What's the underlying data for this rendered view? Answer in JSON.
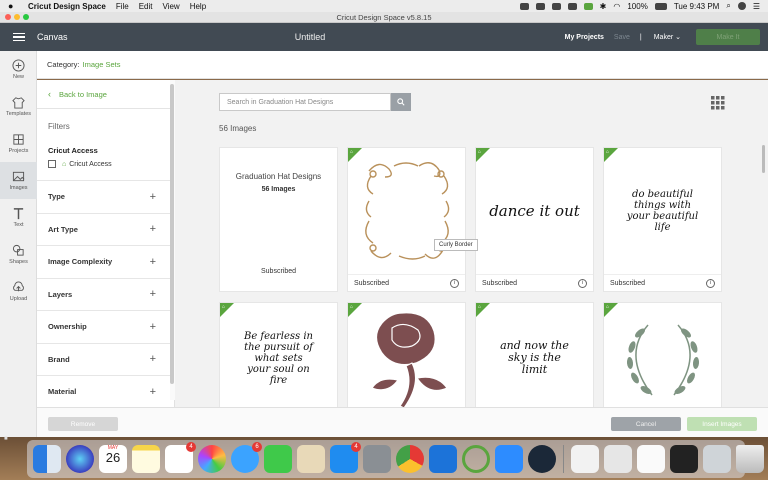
{
  "menubar": {
    "apple": "",
    "items": [
      "Cricut Design Space",
      "File",
      "Edit",
      "View",
      "Help"
    ],
    "battery": "100%",
    "clock": "Tue 9:43 PM"
  },
  "window": {
    "title": "Cricut Design Space  v5.8.15"
  },
  "header": {
    "canvas_label": "Canvas",
    "doc_title": "Untitled",
    "my_projects": "My Projects",
    "save": "Save",
    "divider": "|",
    "machine": "Maker",
    "make_it": "Make It"
  },
  "toolbar": [
    {
      "label": "New",
      "icon": "plus-circle-icon"
    },
    {
      "label": "Templates",
      "icon": "shirt-icon"
    },
    {
      "label": "Projects",
      "icon": "projects-icon"
    },
    {
      "label": "Images",
      "icon": "image-icon"
    },
    {
      "label": "Text",
      "icon": "text-icon"
    },
    {
      "label": "Shapes",
      "icon": "shapes-icon"
    },
    {
      "label": "Upload",
      "icon": "upload-icon"
    }
  ],
  "category": {
    "label": "Category:",
    "value": "Image Sets"
  },
  "filters": {
    "back": "Back to Image",
    "title": "Filters",
    "access_heading": "Cricut Access",
    "access_option": "Cricut Access",
    "facets": [
      "Type",
      "Art Type",
      "Image Complexity",
      "Layers",
      "Ownership",
      "Brand",
      "Material"
    ]
  },
  "search": {
    "placeholder": "Search in Graduation Hat Designs"
  },
  "results": {
    "count": "56 Images"
  },
  "set_card": {
    "title": "Graduation Hat Designs",
    "count": "56 Images",
    "status": "Subscribed"
  },
  "cards": [
    {
      "status": "Subscribed",
      "art": "curly-border"
    },
    {
      "status": "Subscribed",
      "art": "dance-it-out",
      "text": "dance it out"
    },
    {
      "status": "Subscribed",
      "art": "do-beautiful-things",
      "text": "do beautiful things with your beautiful life"
    }
  ],
  "row2": [
    {
      "art": "be-fearless",
      "text": "Be fearless in the pursuit of what sets your soul on fire"
    },
    {
      "art": "rose"
    },
    {
      "art": "and-now-the-sky",
      "text": "and now the sky is the limit"
    },
    {
      "art": "laurel-wreath"
    }
  ],
  "tooltip": "Curly Border",
  "actions": {
    "remove": "Remove",
    "cancel": "Cancel",
    "insert": "Insert Images"
  },
  "dock": {
    "calendar_month": "MAY",
    "calendar_day": "26",
    "reminders_badge": "4",
    "messages_badge": "6",
    "appstore_badge": "4"
  },
  "colors": {
    "accent": "#5aa53e",
    "header": "#414a53"
  }
}
